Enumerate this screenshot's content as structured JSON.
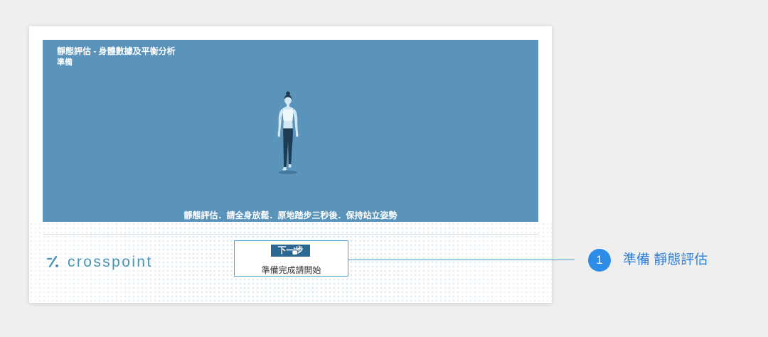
{
  "panel": {
    "title": "靜態評估 - 身體數據及平衡分析",
    "subtitle": "準備",
    "instruction": "靜態評估．請全身放鬆．原地踏步三秒後．保持站立姿勢"
  },
  "figure": {
    "icon": "standing-woman-illustration"
  },
  "logo": {
    "icon": "crosspoint-logo-icon",
    "text": "crosspoint"
  },
  "step_box": {
    "button_label": "下一步",
    "cursor_icon": "hand-pointer-icon",
    "caption": "準備完成請開始"
  },
  "annotation": {
    "number": "1",
    "label": "準備 靜態評估"
  },
  "colors": {
    "page_background": "#efefef",
    "panel": "#5b94ba",
    "accent": "#2d8de6",
    "accent_text": "#2f7fd6",
    "highlight_border": "#4aa3d6",
    "button": "#2a6792",
    "logo": "#4a94b6",
    "figure_dark": "#1d3b52"
  }
}
